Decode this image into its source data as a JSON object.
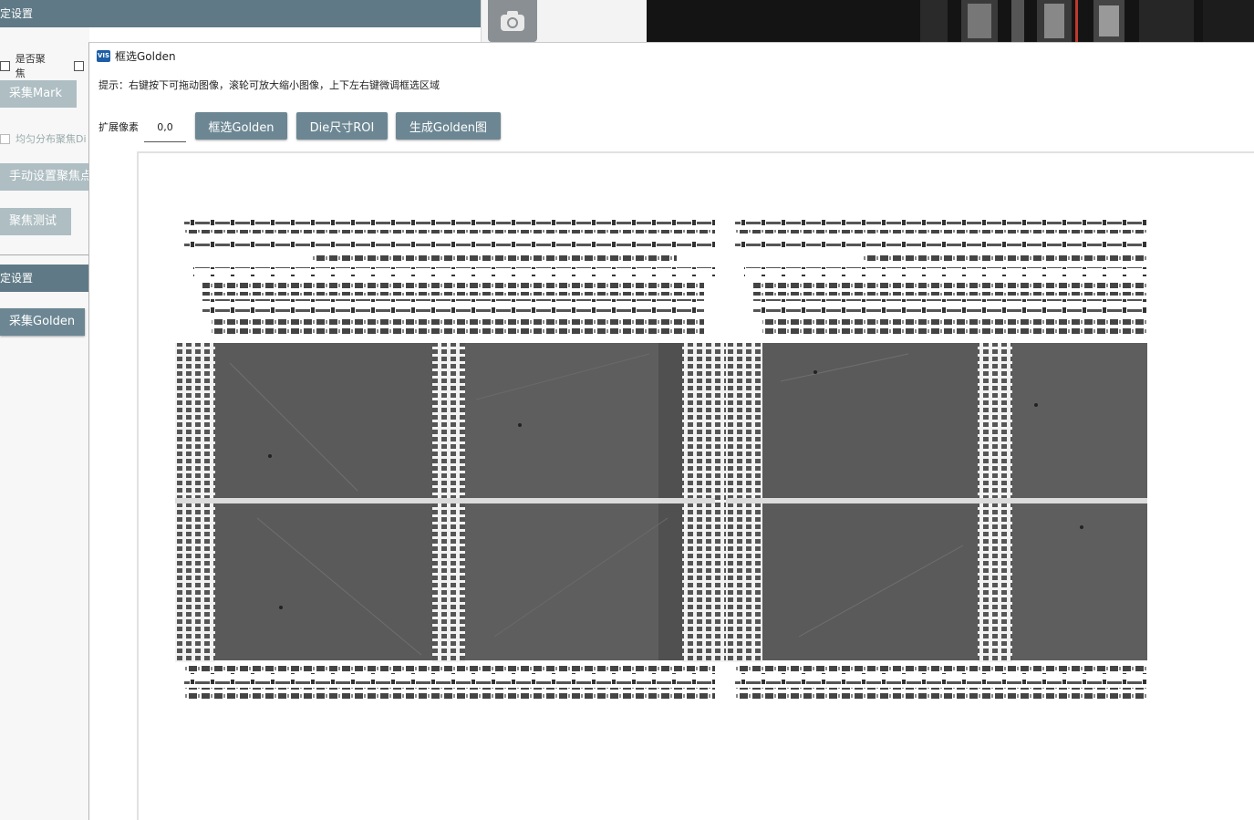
{
  "main_window": {
    "top_section_label": "定设置",
    "focus_checkbox_label": "是否聚焦",
    "collect_mark_button": "采集Mark",
    "even_distribution_label": "均匀分布聚焦Di",
    "manual_focus_button": "手动设置聚焦点",
    "focus_test_button": "聚焦测试",
    "second_section_label": "定设置",
    "collect_golden_button": "采集Golden"
  },
  "dialog": {
    "app_icon_text": "VIS",
    "title": "框选Golden",
    "hint": "提示：右键按下可拖动图像，滚轮可放大缩小图像，上下左右键微调框选区域",
    "expand_pixels_label": "扩展像素",
    "expand_pixels_value": "0,0",
    "buttons": {
      "select_golden": "框选Golden",
      "die_size_roi": "Die尺寸ROI",
      "generate_golden": "生成Golden图"
    }
  },
  "colors": {
    "title_bar": "#5f7a86",
    "button": "#6c8793",
    "button_disabled": "#aebec3"
  }
}
